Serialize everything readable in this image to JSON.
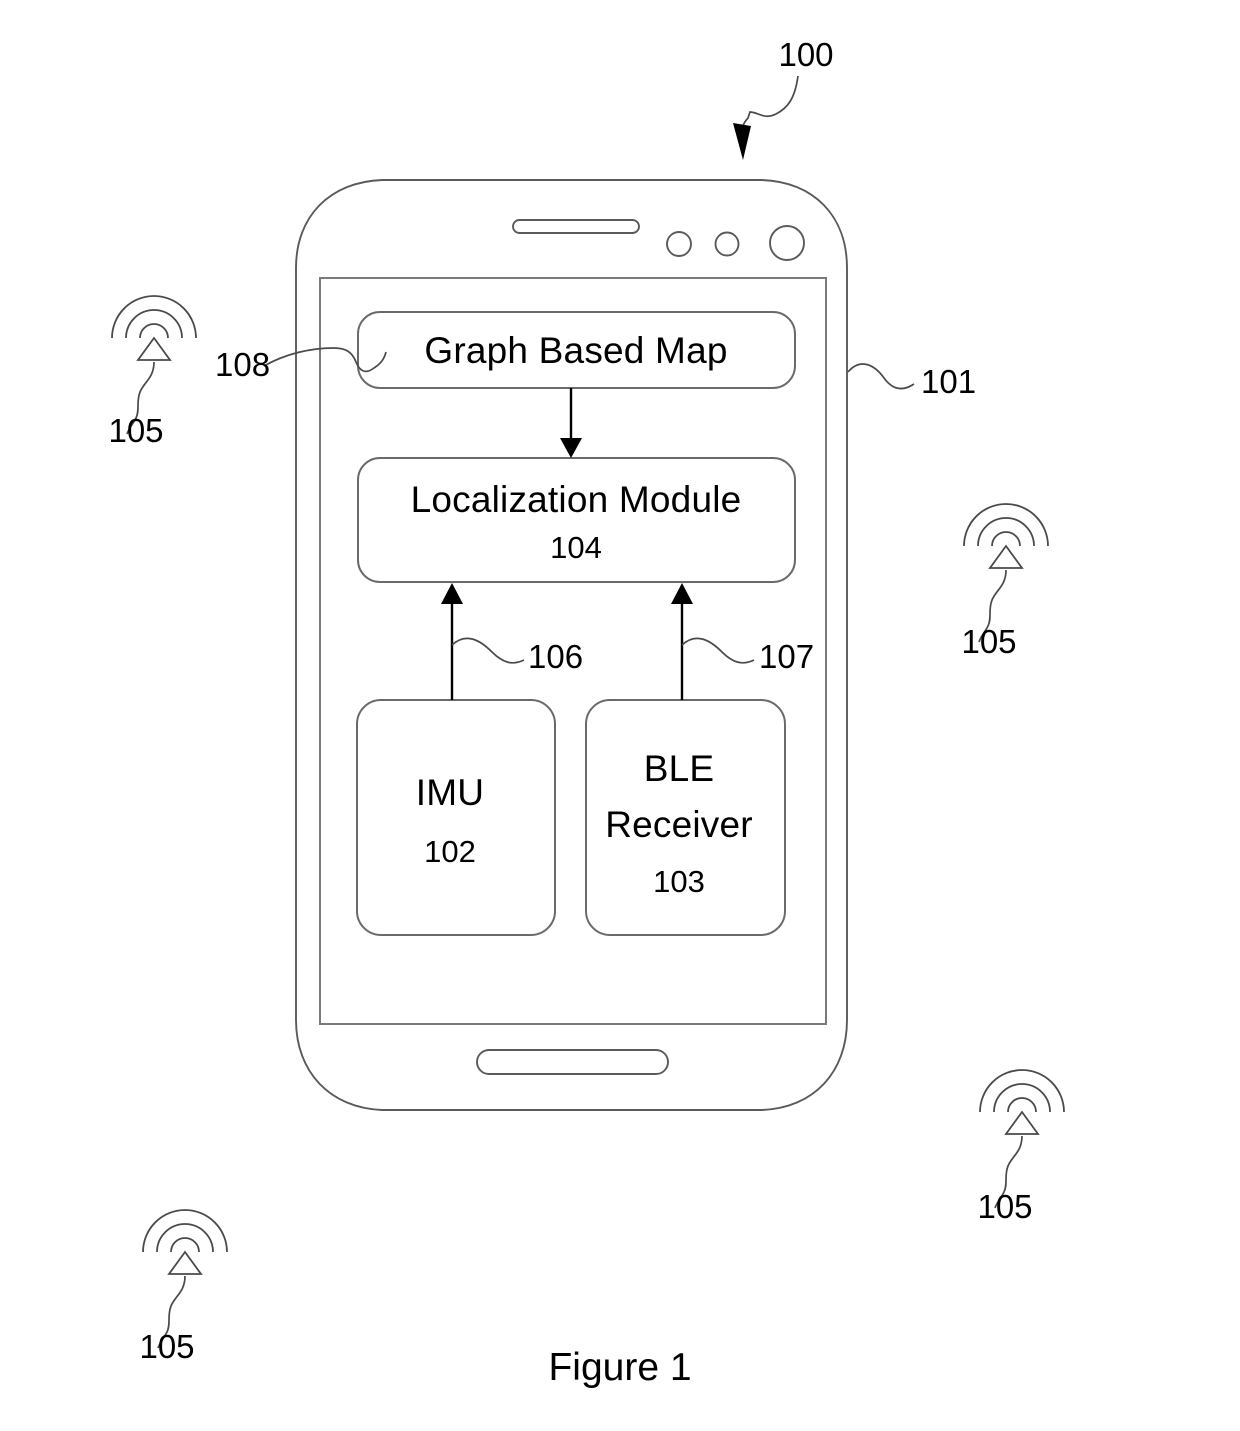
{
  "figure": {
    "caption": "Figure 1",
    "system_ref": "100",
    "device_ref": "101"
  },
  "device": {
    "name": "smartphone",
    "chrome": {
      "speaker_slot": "speaker-slot",
      "sensor_dots": [
        "sensor-dot-1",
        "sensor-dot-2",
        "front-camera"
      ],
      "home_button": "home-button"
    }
  },
  "blocks": [
    {
      "id": "graph-based-map",
      "title": "Graph Based Map",
      "number": "",
      "ref": "108"
    },
    {
      "id": "localization-module",
      "title": "Localization Module",
      "number": "104",
      "ref": "104"
    },
    {
      "id": "imu",
      "title": "IMU",
      "number": "102",
      "ref": "102"
    },
    {
      "id": "ble-receiver",
      "title_line1": "BLE",
      "title_line2": "Receiver",
      "number": "103",
      "ref": "103"
    }
  ],
  "connections": [
    {
      "id": "map-to-localization",
      "from": "graph-based-map",
      "to": "localization-module",
      "direction": "down",
      "ref": ""
    },
    {
      "id": "imu-to-localization",
      "from": "imu",
      "to": "localization-module",
      "direction": "up",
      "ref": "106"
    },
    {
      "id": "ble-to-localization",
      "from": "ble-receiver",
      "to": "localization-module",
      "direction": "up",
      "ref": "107"
    }
  ],
  "beacons": [
    {
      "id": "beacon-top-left",
      "ref": "105"
    },
    {
      "id": "beacon-right",
      "ref": "105"
    },
    {
      "id": "beacon-bottom-right",
      "ref": "105"
    },
    {
      "id": "beacon-bottom-left",
      "ref": "105"
    }
  ],
  "colors": {
    "background": "#ffffff",
    "ink": "#000000",
    "outline": "#5a5a5a"
  }
}
